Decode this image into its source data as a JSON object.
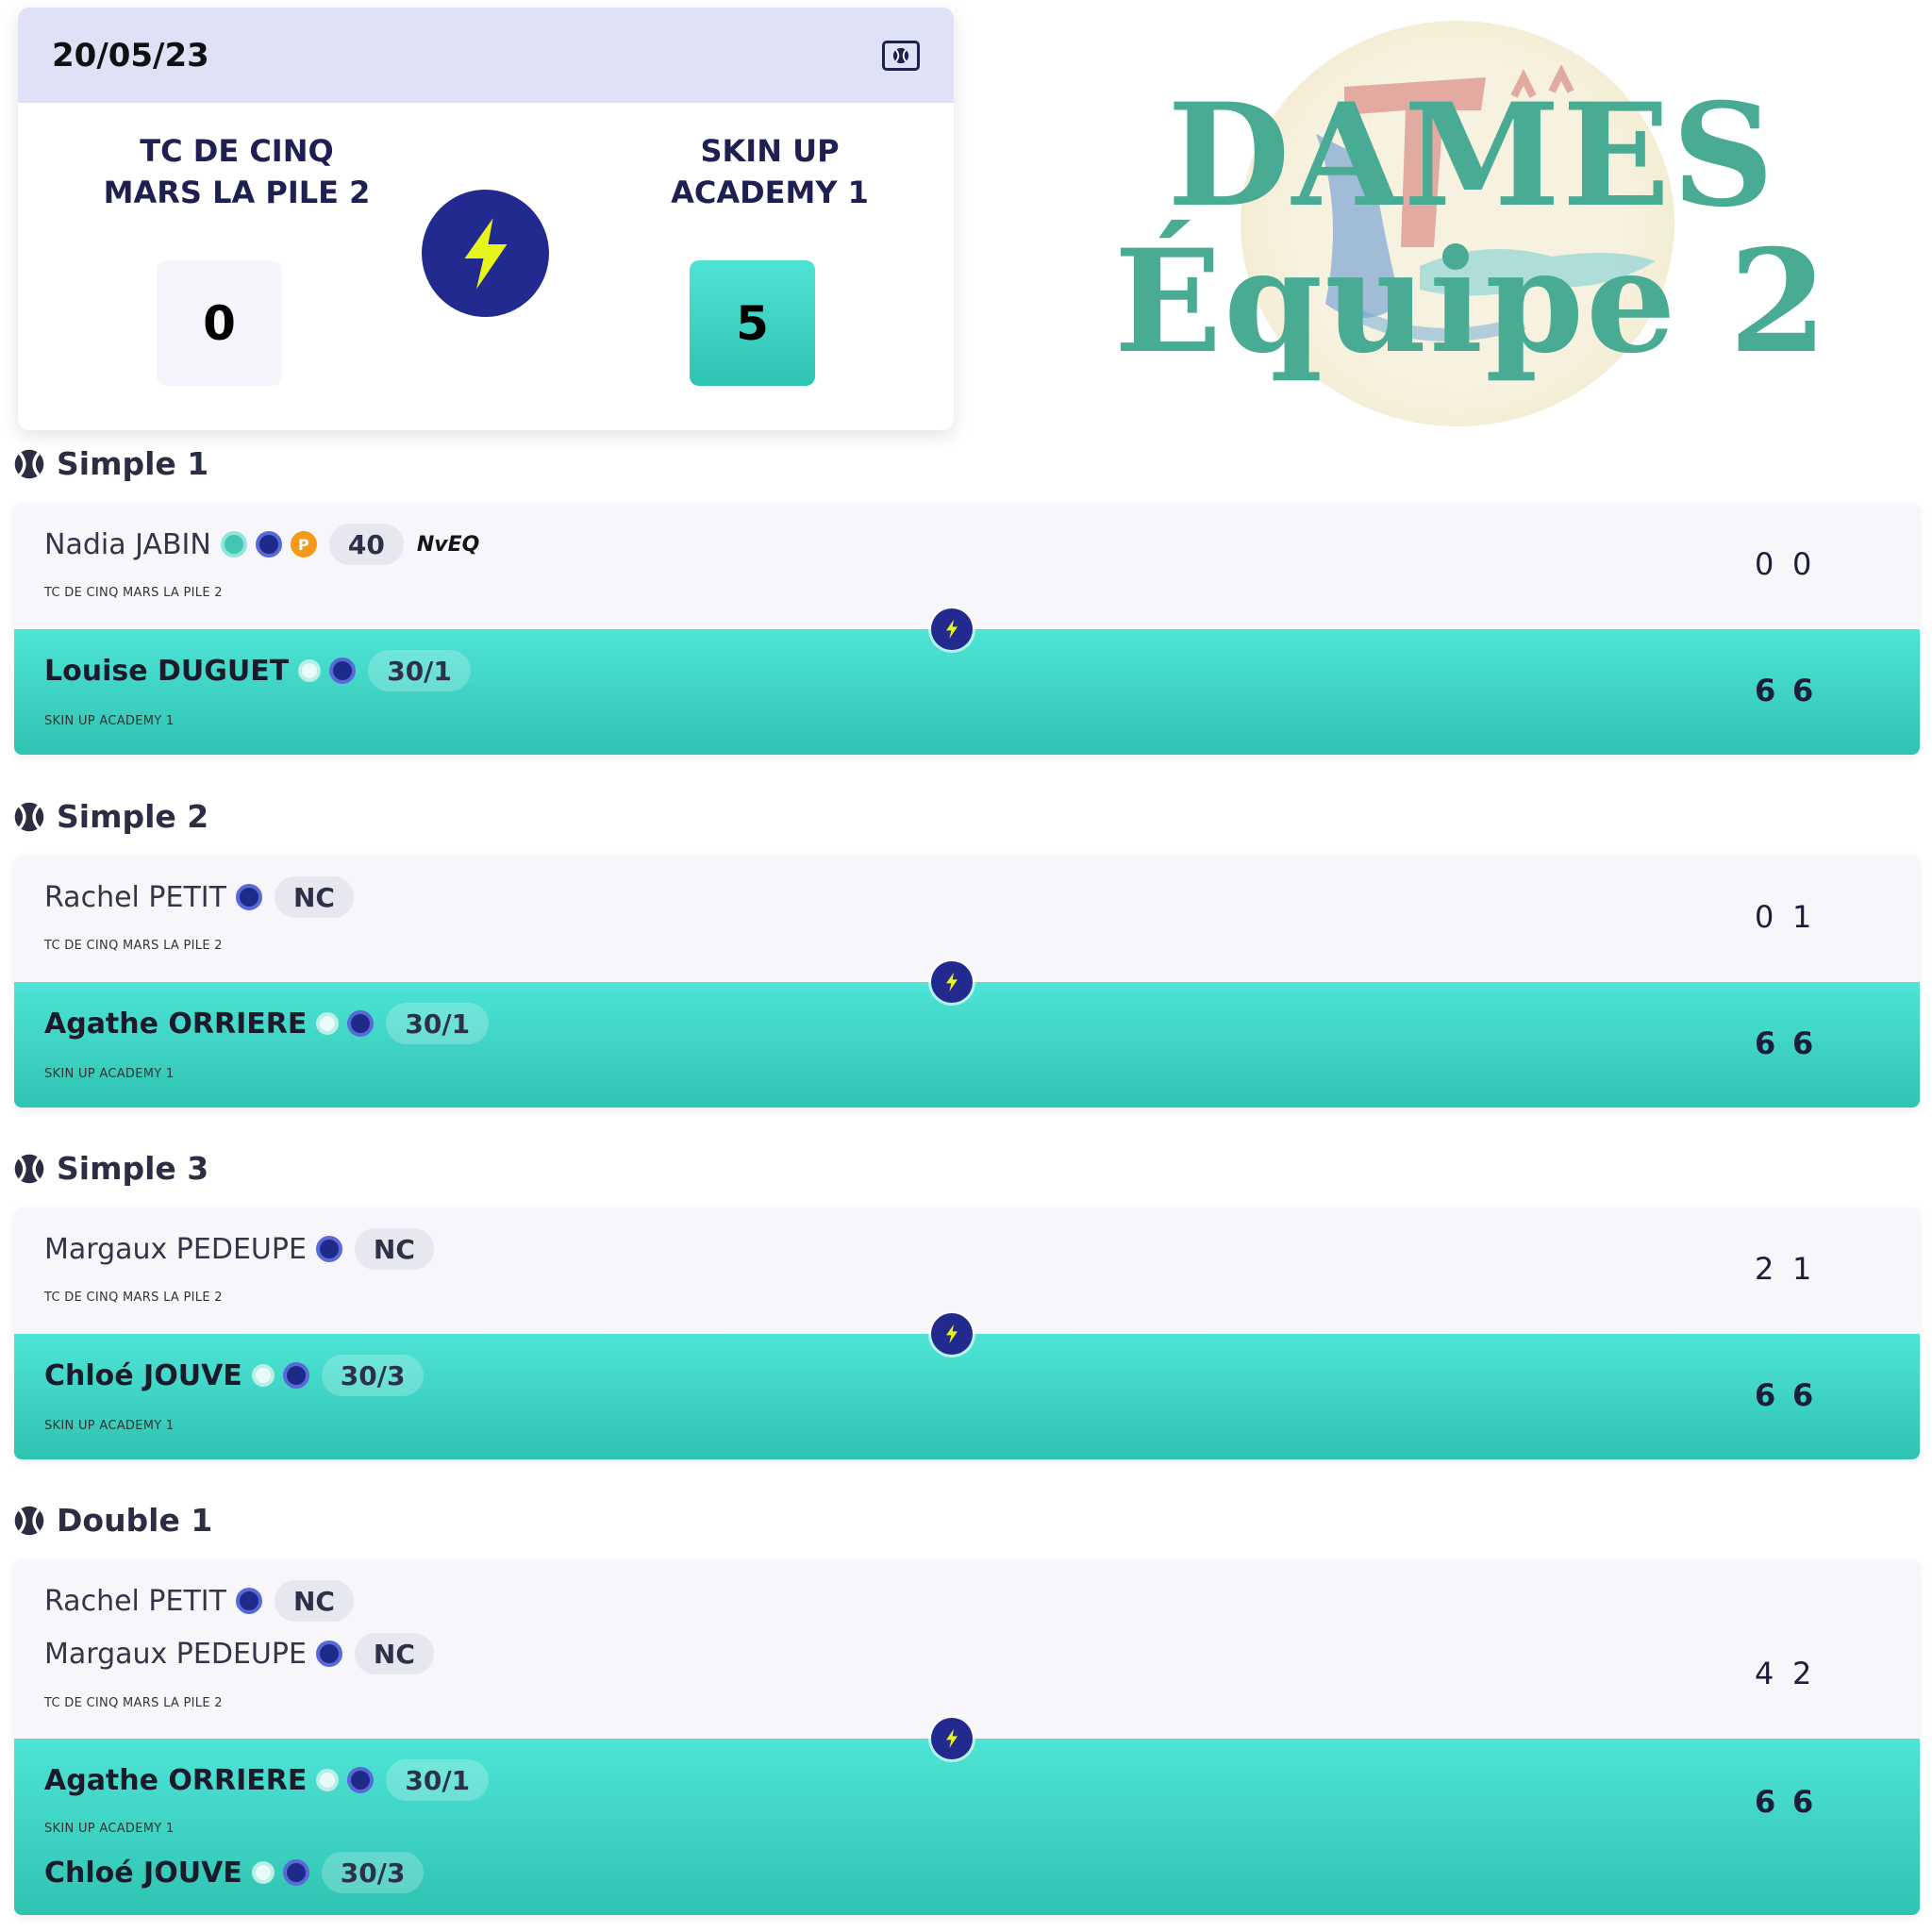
{
  "header": {
    "date": "20/05/23",
    "home_team_line1": "TC DE CINQ",
    "home_team_line2": "MARS LA PILE 2",
    "away_team_line1": "SKIN UP",
    "away_team_line2": "ACADEMY 1",
    "home_score": "0",
    "away_score": "5"
  },
  "logo": {
    "line1": "DAMES",
    "line2": "Équipe 2"
  },
  "colors": {
    "accent": "#4fe3d6",
    "navy": "#232a8f",
    "logo_green": "#4aab95"
  },
  "matches": [
    {
      "title": "Simple 1",
      "home": {
        "players": [
          {
            "name": "Nadia JABIN",
            "badges": [
              "teal",
              "navy",
              "orange"
            ],
            "badge_letter": "P",
            "rank": "40",
            "tag": "NvEQ"
          }
        ],
        "club": "TC DE CINQ MARS LA PILE 2",
        "sets": [
          "0",
          "0"
        ]
      },
      "away": {
        "players": [
          {
            "name": "Louise DUGUET",
            "badges": [
              "white",
              "navy"
            ],
            "rank": "30/1"
          }
        ],
        "club": "SKIN UP ACADEMY 1",
        "sets": [
          "6",
          "6"
        ]
      }
    },
    {
      "title": "Simple 2",
      "home": {
        "players": [
          {
            "name": "Rachel PETIT",
            "badges": [
              "navy"
            ],
            "rank": "NC"
          }
        ],
        "club": "TC DE CINQ MARS LA PILE 2",
        "sets": [
          "0",
          "1"
        ]
      },
      "away": {
        "players": [
          {
            "name": "Agathe ORRIERE",
            "badges": [
              "white",
              "navy"
            ],
            "rank": "30/1"
          }
        ],
        "club": "SKIN UP ACADEMY 1",
        "sets": [
          "6",
          "6"
        ]
      }
    },
    {
      "title": "Simple 3",
      "home": {
        "players": [
          {
            "name": "Margaux PEDEUPE",
            "badges": [
              "navy"
            ],
            "rank": "NC"
          }
        ],
        "club": "TC DE CINQ MARS LA PILE 2",
        "sets": [
          "2",
          "1"
        ]
      },
      "away": {
        "players": [
          {
            "name": "Chloé JOUVE",
            "badges": [
              "white",
              "navy"
            ],
            "rank": "30/3"
          }
        ],
        "club": "SKIN UP ACADEMY 1",
        "sets": [
          "6",
          "6"
        ]
      }
    },
    {
      "title": "Double 1",
      "home": {
        "players": [
          {
            "name": "Rachel PETIT",
            "badges": [
              "navy"
            ],
            "rank": "NC"
          },
          {
            "name": "Margaux PEDEUPE",
            "badges": [
              "navy"
            ],
            "rank": "NC"
          }
        ],
        "club": "TC DE CINQ MARS LA PILE 2",
        "sets": [
          "4",
          "2"
        ]
      },
      "away": {
        "players": [
          {
            "name": "Agathe ORRIERE",
            "badges": [
              "white",
              "navy"
            ],
            "rank": "30/1"
          },
          {
            "name": "Chloé JOUVE",
            "badges": [
              "white",
              "navy"
            ],
            "rank": "30/3"
          }
        ],
        "club": "SKIN UP ACADEMY 1",
        "sets": [
          "6",
          "6"
        ]
      }
    }
  ]
}
